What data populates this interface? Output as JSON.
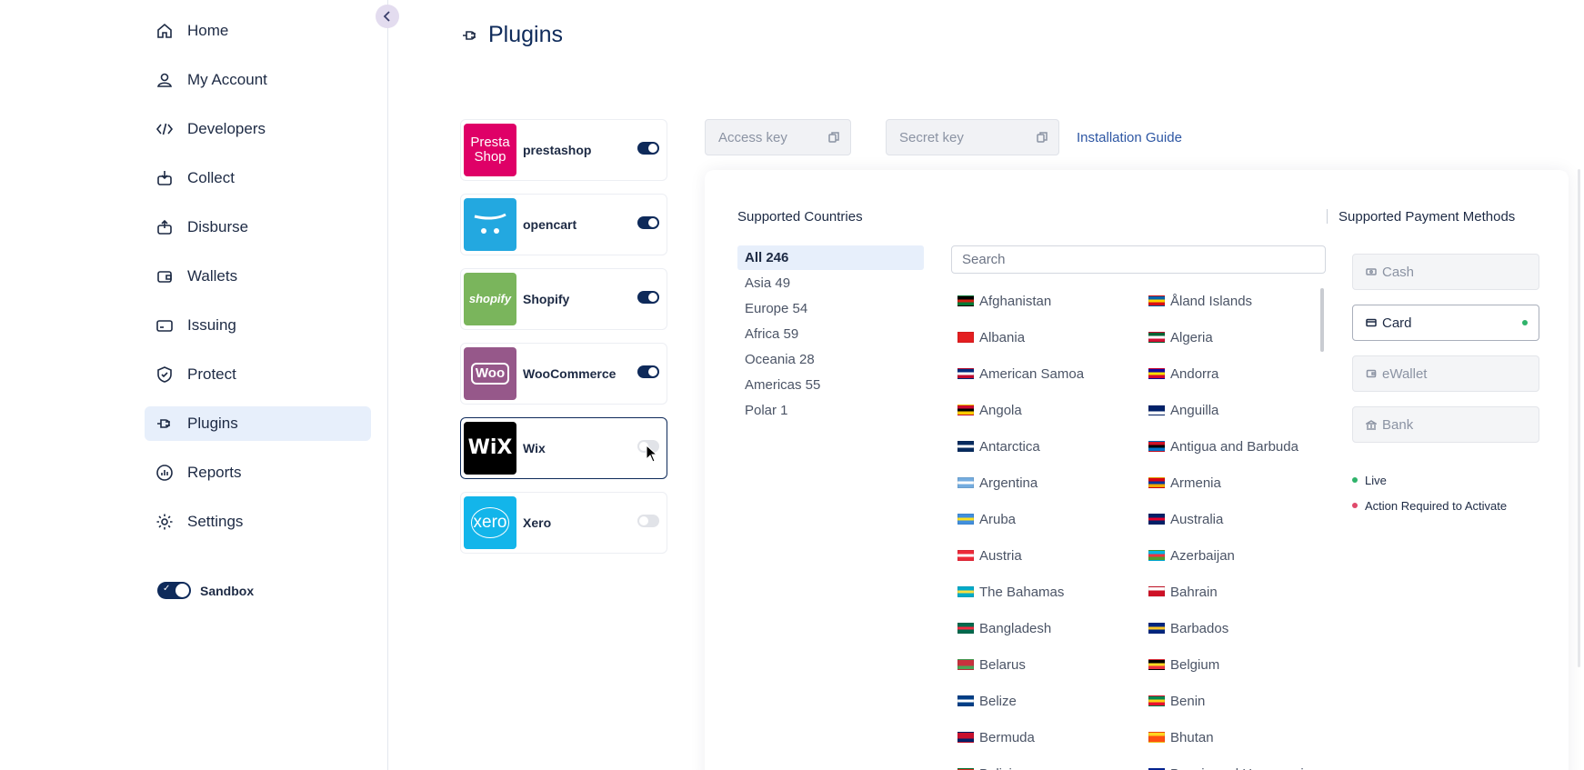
{
  "sidebar": {
    "items": [
      {
        "label": "Home",
        "icon": "home-icon"
      },
      {
        "label": "My Account",
        "icon": "user-icon"
      },
      {
        "label": "Developers",
        "icon": "code-icon"
      },
      {
        "label": "Collect",
        "icon": "collect-icon"
      },
      {
        "label": "Disburse",
        "icon": "disburse-icon"
      },
      {
        "label": "Wallets",
        "icon": "wallet-icon"
      },
      {
        "label": "Issuing",
        "icon": "card-icon"
      },
      {
        "label": "Protect",
        "icon": "shield-icon"
      },
      {
        "label": "Plugins",
        "icon": "plug-icon",
        "active": true
      },
      {
        "label": "Reports",
        "icon": "reports-icon"
      },
      {
        "label": "Settings",
        "icon": "gear-icon"
      }
    ],
    "sandbox_label": "Sandbox",
    "sandbox_on": true
  },
  "page": {
    "title": "Plugins"
  },
  "plugins": [
    {
      "name": "prestashop",
      "logo_text": "Presta Shop",
      "color": "#df0067",
      "enabled": true
    },
    {
      "name": "opencart",
      "logo_text": "",
      "color": "#23a8e0",
      "enabled": true
    },
    {
      "name": "Shopify",
      "logo_text": "shopify",
      "color": "#7ab55c",
      "enabled": true
    },
    {
      "name": "WooCommerce",
      "logo_text": "Woo",
      "color": "#96588a",
      "enabled": true
    },
    {
      "name": "Wix",
      "logo_text": "WiX",
      "color": "#000000",
      "enabled": false,
      "selected": true
    },
    {
      "name": "Xero",
      "logo_text": "xero",
      "color": "#13b5ea",
      "enabled": false
    }
  ],
  "keys": {
    "access_placeholder": "Access key",
    "secret_placeholder": "Secret key",
    "guide_label": "Installation Guide"
  },
  "countries_section": {
    "title": "Supported Countries",
    "search_placeholder": "Search",
    "regions": [
      {
        "label": "All 246",
        "active": true
      },
      {
        "label": "Asia 49"
      },
      {
        "label": "Europe 54"
      },
      {
        "label": "Africa 59"
      },
      {
        "label": "Oceania 28"
      },
      {
        "label": "Americas 55"
      },
      {
        "label": "Polar 1"
      }
    ],
    "countries": [
      {
        "name": "Afghanistan",
        "flag": [
          "#000000",
          "#d32011",
          "#007a36"
        ]
      },
      {
        "name": "Åland Islands",
        "flag": [
          "#0064ad",
          "#ffd300",
          "#da0e15"
        ]
      },
      {
        "name": "Albania",
        "flag": [
          "#e41e20",
          "#e41e20",
          "#e41e20"
        ]
      },
      {
        "name": "Algeria",
        "flag": [
          "#006233",
          "#ffffff",
          "#d21034"
        ]
      },
      {
        "name": "American Samoa",
        "flag": [
          "#002b7f",
          "#ffffff",
          "#bf0a30"
        ]
      },
      {
        "name": "Andorra",
        "flag": [
          "#10069f",
          "#fedd00",
          "#d50032"
        ]
      },
      {
        "name": "Angola",
        "flag": [
          "#cc092f",
          "#000000",
          "#ffcb00"
        ]
      },
      {
        "name": "Anguilla",
        "flag": [
          "#012169",
          "#012169",
          "#ffffff"
        ]
      },
      {
        "name": "Antarctica",
        "flag": [
          "#072b5f",
          "#ffffff",
          "#072b5f"
        ]
      },
      {
        "name": "Antigua and Barbuda",
        "flag": [
          "#ce1126",
          "#000000",
          "#0072c6"
        ]
      },
      {
        "name": "Argentina",
        "flag": [
          "#74acdf",
          "#ffffff",
          "#74acdf"
        ]
      },
      {
        "name": "Armenia",
        "flag": [
          "#d90012",
          "#0033a0",
          "#f2a800"
        ]
      },
      {
        "name": "Aruba",
        "flag": [
          "#418fde",
          "#fbe122",
          "#418fde"
        ]
      },
      {
        "name": "Australia",
        "flag": [
          "#012169",
          "#e4002b",
          "#012169"
        ]
      },
      {
        "name": "Austria",
        "flag": [
          "#ed2939",
          "#ffffff",
          "#ed2939"
        ]
      },
      {
        "name": "Azerbaijan",
        "flag": [
          "#00b5e2",
          "#ef3340",
          "#509e2f"
        ]
      },
      {
        "name": "The Bahamas",
        "flag": [
          "#00abc9",
          "#fae042",
          "#00abc9"
        ]
      },
      {
        "name": "Bahrain",
        "flag": [
          "#ffffff",
          "#ce1126",
          "#ce1126"
        ]
      },
      {
        "name": "Bangladesh",
        "flag": [
          "#006a4e",
          "#f42a41",
          "#006a4e"
        ]
      },
      {
        "name": "Barbados",
        "flag": [
          "#00267f",
          "#ffc726",
          "#00267f"
        ]
      },
      {
        "name": "Belarus",
        "flag": [
          "#c8313e",
          "#c8313e",
          "#4aa657"
        ]
      },
      {
        "name": "Belgium",
        "flag": [
          "#000000",
          "#fdda24",
          "#ef3340"
        ]
      },
      {
        "name": "Belize",
        "flag": [
          "#003f87",
          "#ffffff",
          "#003f87"
        ]
      },
      {
        "name": "Benin",
        "flag": [
          "#008751",
          "#fcd116",
          "#e8112d"
        ]
      },
      {
        "name": "Bermuda",
        "flag": [
          "#c8102e",
          "#c8102e",
          "#012169"
        ]
      },
      {
        "name": "Bhutan",
        "flag": [
          "#ffd520",
          "#ff4e12",
          "#ff4e12"
        ]
      },
      {
        "name": "Bolivia",
        "flag": [
          "#d52b1e",
          "#f9e300",
          "#007934"
        ]
      },
      {
        "name": "Bosnia and Herzegovina",
        "flag": [
          "#002395",
          "#fecb00",
          "#002395"
        ]
      }
    ]
  },
  "methods_section": {
    "title": "Supported Payment Methods",
    "methods": [
      {
        "label": "Cash",
        "icon": "cash-icon",
        "active": false
      },
      {
        "label": "Card",
        "icon": "card-icon",
        "active": true
      },
      {
        "label": "eWallet",
        "icon": "wallet-icon",
        "active": false
      },
      {
        "label": "Bank",
        "icon": "bank-icon",
        "active": false
      }
    ],
    "legend": [
      {
        "label": "Live",
        "color": "#2fb36a"
      },
      {
        "label": "Action Required to Activate",
        "color": "#e0496b"
      }
    ]
  }
}
